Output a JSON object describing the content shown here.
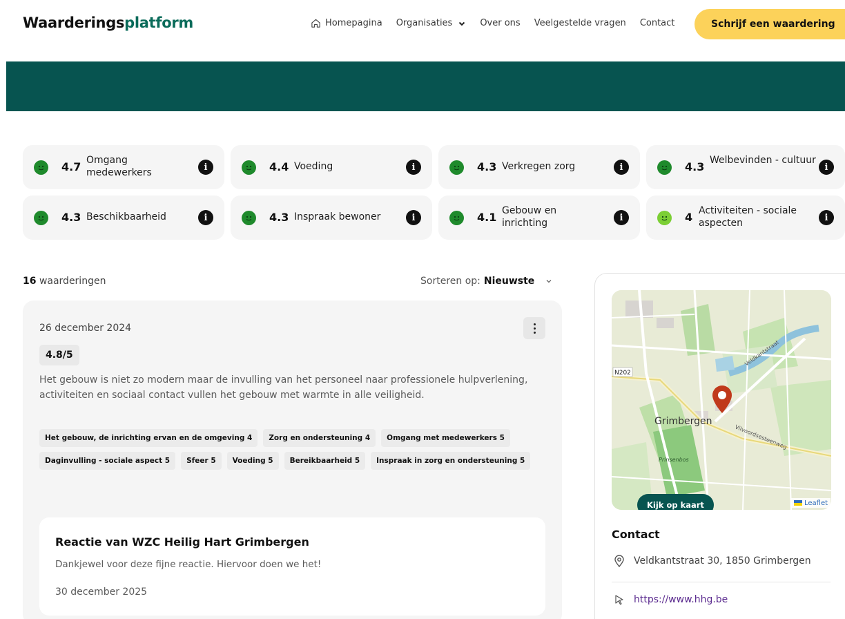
{
  "header": {
    "logo_main": "Waarderings",
    "logo_accent": "platform",
    "nav": {
      "home": "Homepagina",
      "organisations": "Organisaties",
      "about": "Over ons",
      "faq": "Veelgestelde vragen",
      "contact": "Contact"
    },
    "cta": "Schrijf een waardering"
  },
  "colors": {
    "brand_dark": "#075450",
    "accent_yellow": "#fcd25a",
    "score_green": "#1f8a2c",
    "score_lightgreen": "#7ccf35"
  },
  "scores": [
    {
      "value": "4.7",
      "label": "Omgang medewerkers",
      "icon": "smiley-icon",
      "color": "#1f8a2c"
    },
    {
      "value": "4.4",
      "label": "Voeding",
      "icon": "smiley-icon",
      "color": "#1f8a2c"
    },
    {
      "value": "4.3",
      "label": "Verkregen zorg",
      "icon": "smiley-icon",
      "color": "#1f8a2c"
    },
    {
      "value": "4.3",
      "label": "Welbevinden - cultuur",
      "icon": "smiley-icon",
      "color": "#1f8a2c"
    },
    {
      "value": "4.3",
      "label": "Beschikbaarheid",
      "icon": "smiley-icon",
      "color": "#1f8a2c"
    },
    {
      "value": "4.3",
      "label": "Inspraak bewoner",
      "icon": "smiley-icon",
      "color": "#1f8a2c"
    },
    {
      "value": "4.1",
      "label": "Gebouw en inrichting",
      "icon": "smiley-icon",
      "color": "#1f8a2c"
    },
    {
      "value": "4",
      "label": "Activiteiten - sociale aspecten",
      "icon": "smiley-icon",
      "color": "#7ccf35"
    }
  ],
  "reviews_header": {
    "count": "16",
    "count_label": "waarderingen",
    "sort_label": "Sorteren op:",
    "sort_value": "Nieuwste"
  },
  "review": {
    "date": "26 december 2024",
    "score": "4.8/5",
    "text": "Het gebouw is niet zo modern maar de invulling van het personeel naar professionele hulpverlening, activiteiten en sociaal contact vullen het gebouw met warmte in alle veiligheid.",
    "tags": [
      "Het gebouw, de inrichting ervan en de omgeving 4",
      "Zorg en ondersteuning 4",
      "Omgang met medewerkers 5",
      "Daginvulling - sociale aspect 5",
      "Sfeer 5",
      "Voeding 5",
      "Bereikbaarheid 5",
      "Inspraak in zorg en ondersteuning 5"
    ],
    "reply": {
      "title": "Reactie van WZC Heilig Hart Grimbergen",
      "text": "Dankjewel voor deze fijne reactie. Hiervoor doen we het!",
      "date": "30 december 2025"
    }
  },
  "sidebar": {
    "map": {
      "place": "Grimbergen",
      "road_label": "N202",
      "street1": "Veldkantstraat",
      "street2": "Vilvoordsesteenweg",
      "park": "Prinsenbos",
      "button": "Kijk op kaart",
      "attribution": "Leaflet"
    },
    "contact_title": "Contact",
    "address": "Veldkantstraat 30, 1850 Grimbergen",
    "website": "https://www.hhg.be"
  }
}
